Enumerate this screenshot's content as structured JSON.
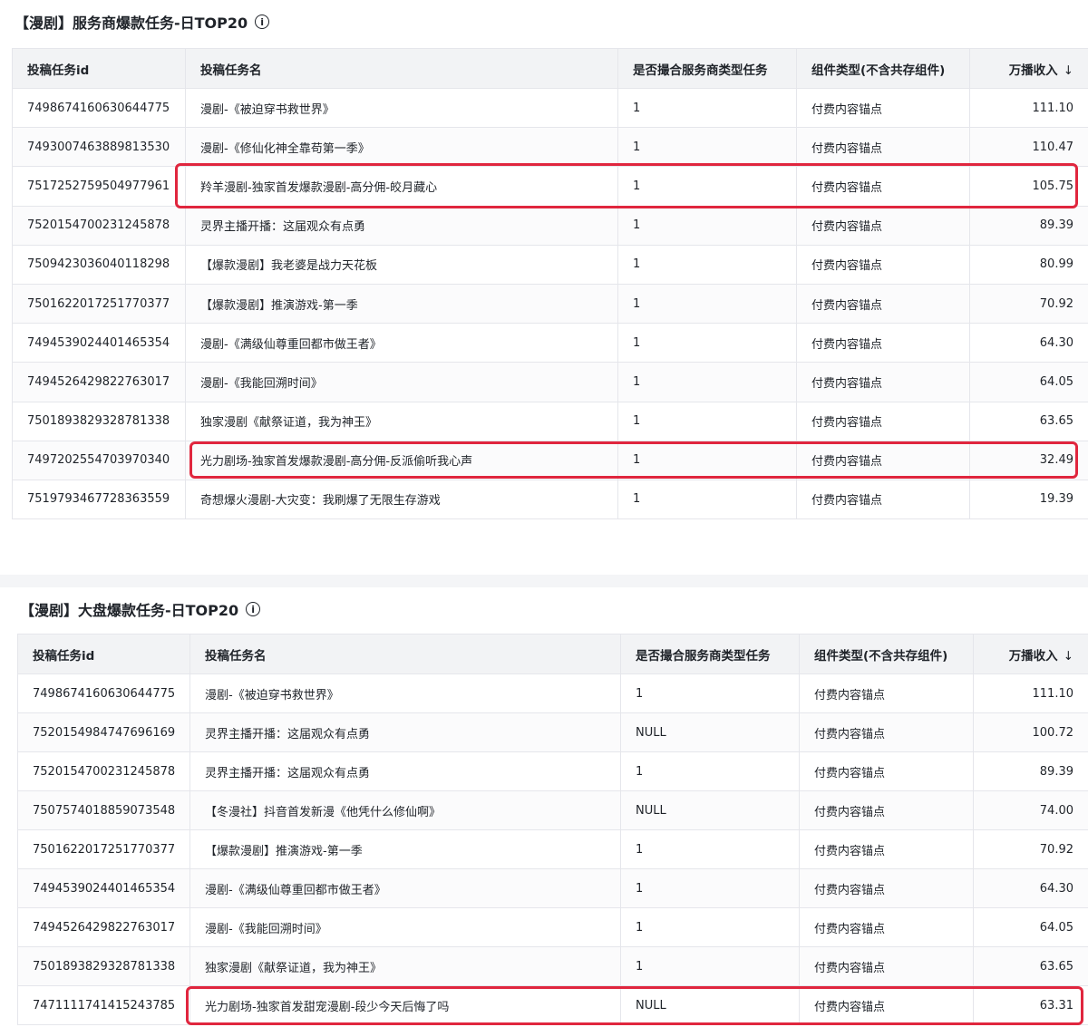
{
  "panel1": {
    "title": "【漫剧】服务商爆款任务-日TOP20",
    "info_icon": "info-icon",
    "columns": [
      "投稿任务id",
      "投稿任务名",
      "是否撮合服务商类型任务",
      "组件类型(不含共存组件)",
      "万播收入"
    ],
    "sort_arrow": "↓",
    "rows": [
      [
        "7498674160630644775",
        "漫剧-《被迫穿书救世界》",
        "1",
        "付费内容锚点",
        "111.10"
      ],
      [
        "7493007463889813530",
        "漫剧-《修仙化神全靠苟第一季》",
        "1",
        "付费内容锚点",
        "110.47"
      ],
      [
        "7517252759504977961",
        "羚羊漫剧-独家首发爆款漫剧-高分佣-皎月藏心",
        "1",
        "付费内容锚点",
        "105.75"
      ],
      [
        "7520154700231245878",
        "灵界主播开播：这届观众有点勇",
        "1",
        "付费内容锚点",
        "89.39"
      ],
      [
        "7509423036040118298",
        "【爆款漫剧】我老婆是战力天花板",
        "1",
        "付费内容锚点",
        "80.99"
      ],
      [
        "7501622017251770377",
        "【爆款漫剧】推演游戏-第一季",
        "1",
        "付费内容锚点",
        "70.92"
      ],
      [
        "7494539024401465354",
        "漫剧-《满级仙尊重回都市做王者》",
        "1",
        "付费内容锚点",
        "64.30"
      ],
      [
        "7494526429822763017",
        "漫剧-《我能回溯时间》",
        "1",
        "付费内容锚点",
        "64.05"
      ],
      [
        "7501893829328781338",
        "独家漫剧《献祭证道，我为神王》",
        "1",
        "付费内容锚点",
        "63.65"
      ],
      [
        "7497202554703970340",
        "光力剧场-独家首发爆款漫剧-高分佣-反派偷听我心声",
        "1",
        "付费内容锚点",
        "32.49"
      ],
      [
        "7519793467728363559",
        "奇想爆火漫剧-大灾变：我刷爆了无限生存游戏",
        "1",
        "付费内容锚点",
        "19.39"
      ]
    ]
  },
  "panel2": {
    "title": "【漫剧】大盘爆款任务-日TOP20",
    "info_icon": "info-icon",
    "columns": [
      "投稿任务id",
      "投稿任务名",
      "是否撮合服务商类型任务",
      "组件类型(不含共存组件)",
      "万播收入"
    ],
    "sort_arrow": "↓",
    "rows": [
      [
        "7498674160630644775",
        "漫剧-《被迫穿书救世界》",
        "1",
        "付费内容锚点",
        "111.10"
      ],
      [
        "7520154984747696169",
        "灵界主播开播：这届观众有点勇",
        "NULL",
        "付费内容锚点",
        "100.72"
      ],
      [
        "7520154700231245878",
        "灵界主播开播：这届观众有点勇",
        "1",
        "付费内容锚点",
        "89.39"
      ],
      [
        "7507574018859073548",
        "【冬漫社】抖音首发新漫《他凭什么修仙啊》",
        "NULL",
        "付费内容锚点",
        "74.00"
      ],
      [
        "7501622017251770377",
        "【爆款漫剧】推演游戏-第一季",
        "1",
        "付费内容锚点",
        "70.92"
      ],
      [
        "7494539024401465354",
        "漫剧-《满级仙尊重回都市做王者》",
        "1",
        "付费内容锚点",
        "64.30"
      ],
      [
        "7494526429822763017",
        "漫剧-《我能回溯时间》",
        "1",
        "付费内容锚点",
        "64.05"
      ],
      [
        "7501893829328781338",
        "独家漫剧《献祭证道，我为神王》",
        "1",
        "付费内容锚点",
        "63.65"
      ],
      [
        "7471111741415243785",
        "光力剧场-独家首发甜宠漫剧-段少今天后悔了吗",
        "NULL",
        "付费内容锚点",
        "63.31"
      ]
    ]
  },
  "colors": {
    "highlight": "#e0263e",
    "header_bg": "#f2f3f5",
    "border": "#e5e6eb"
  }
}
